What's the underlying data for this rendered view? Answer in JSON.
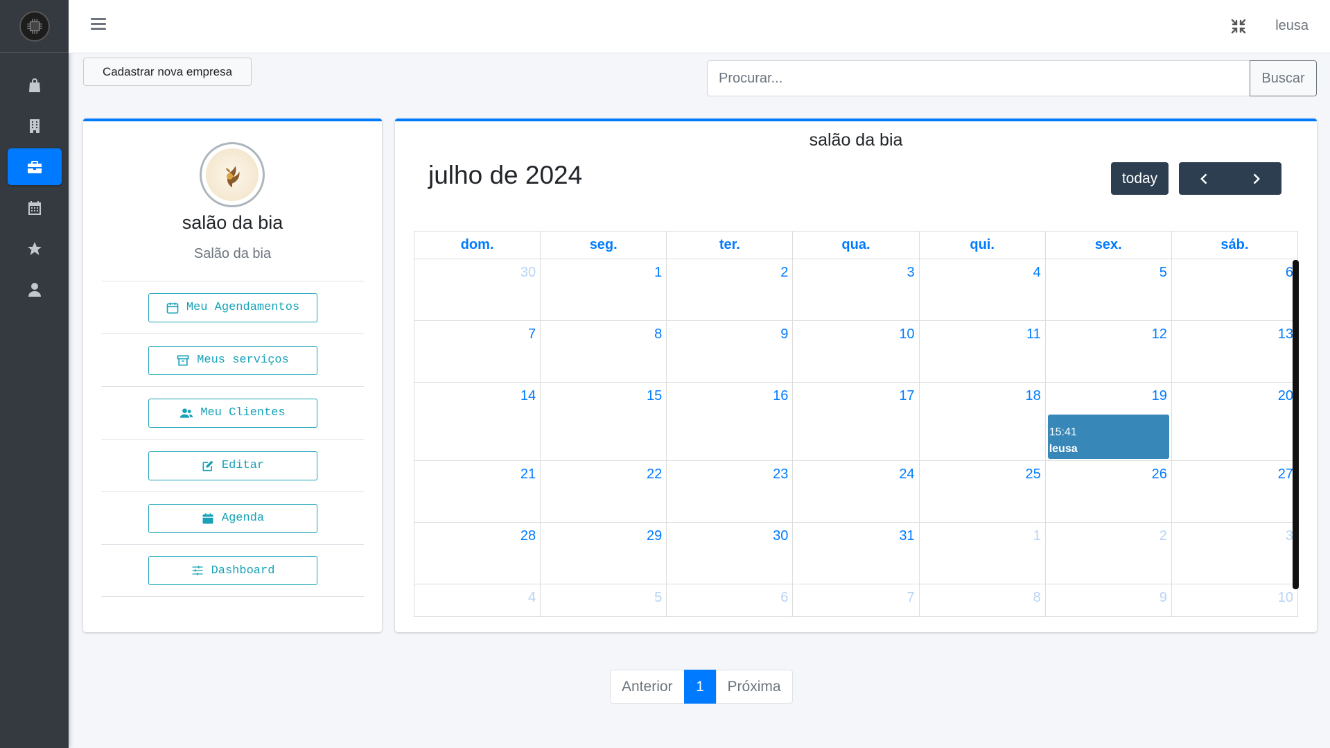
{
  "sidebar": {
    "items": [
      {
        "icon": "shopping-bag-icon",
        "active": false
      },
      {
        "icon": "building-icon",
        "active": false
      },
      {
        "icon": "briefcase-icon",
        "active": true
      },
      {
        "icon": "calendar-icon",
        "active": false
      },
      {
        "icon": "star-icon",
        "active": false
      },
      {
        "icon": "user-icon",
        "active": false
      }
    ]
  },
  "topbar": {
    "user_name": "leusa"
  },
  "actions": {
    "new_company_label": "Cadastrar nova empresa",
    "search_placeholder": "Procurar...",
    "search_button": "Buscar"
  },
  "profile": {
    "name": "salão da bia",
    "subtitle": "Salão da bia",
    "menu": [
      {
        "label": "Meu Agendamentos",
        "icon": "calendar-icon"
      },
      {
        "label": "Meus serviços",
        "icon": "archive-icon"
      },
      {
        "label": "Meu Clientes",
        "icon": "users-icon"
      },
      {
        "label": "Editar",
        "icon": "edit-icon"
      },
      {
        "label": "Agenda",
        "icon": "calendar-day-icon"
      },
      {
        "label": "Dashboard",
        "icon": "sliders-icon"
      }
    ]
  },
  "calendar": {
    "title": "salão da bia",
    "month_label": "julho de 2024",
    "today_label": "today",
    "weekdays": [
      "dom.",
      "seg.",
      "ter.",
      "qua.",
      "qui.",
      "sex.",
      "sáb."
    ],
    "weeks": [
      [
        {
          "d": "30",
          "o": true
        },
        {
          "d": "1"
        },
        {
          "d": "2"
        },
        {
          "d": "3"
        },
        {
          "d": "4"
        },
        {
          "d": "5"
        },
        {
          "d": "6"
        }
      ],
      [
        {
          "d": "7"
        },
        {
          "d": "8"
        },
        {
          "d": "9"
        },
        {
          "d": "10"
        },
        {
          "d": "11"
        },
        {
          "d": "12"
        },
        {
          "d": "13"
        }
      ],
      [
        {
          "d": "14"
        },
        {
          "d": "15"
        },
        {
          "d": "16"
        },
        {
          "d": "17"
        },
        {
          "d": "18"
        },
        {
          "d": "19",
          "event": {
            "time": "15:41",
            "title": "leusa"
          }
        },
        {
          "d": "20"
        }
      ],
      [
        {
          "d": "21"
        },
        {
          "d": "22"
        },
        {
          "d": "23"
        },
        {
          "d": "24"
        },
        {
          "d": "25"
        },
        {
          "d": "26"
        },
        {
          "d": "27"
        }
      ],
      [
        {
          "d": "28"
        },
        {
          "d": "29"
        },
        {
          "d": "30"
        },
        {
          "d": "31"
        },
        {
          "d": "1",
          "o": true
        },
        {
          "d": "2",
          "o": true
        },
        {
          "d": "3",
          "o": true
        }
      ],
      [
        {
          "d": "4",
          "o": true
        },
        {
          "d": "5",
          "o": true
        },
        {
          "d": "6",
          "o": true
        },
        {
          "d": "7",
          "o": true
        },
        {
          "d": "8",
          "o": true
        },
        {
          "d": "9",
          "o": true
        },
        {
          "d": "10",
          "o": true
        }
      ]
    ],
    "event_color": "#3788b8"
  },
  "pagination": {
    "previous": "Anterior",
    "current": "1",
    "next": "Próxima"
  }
}
